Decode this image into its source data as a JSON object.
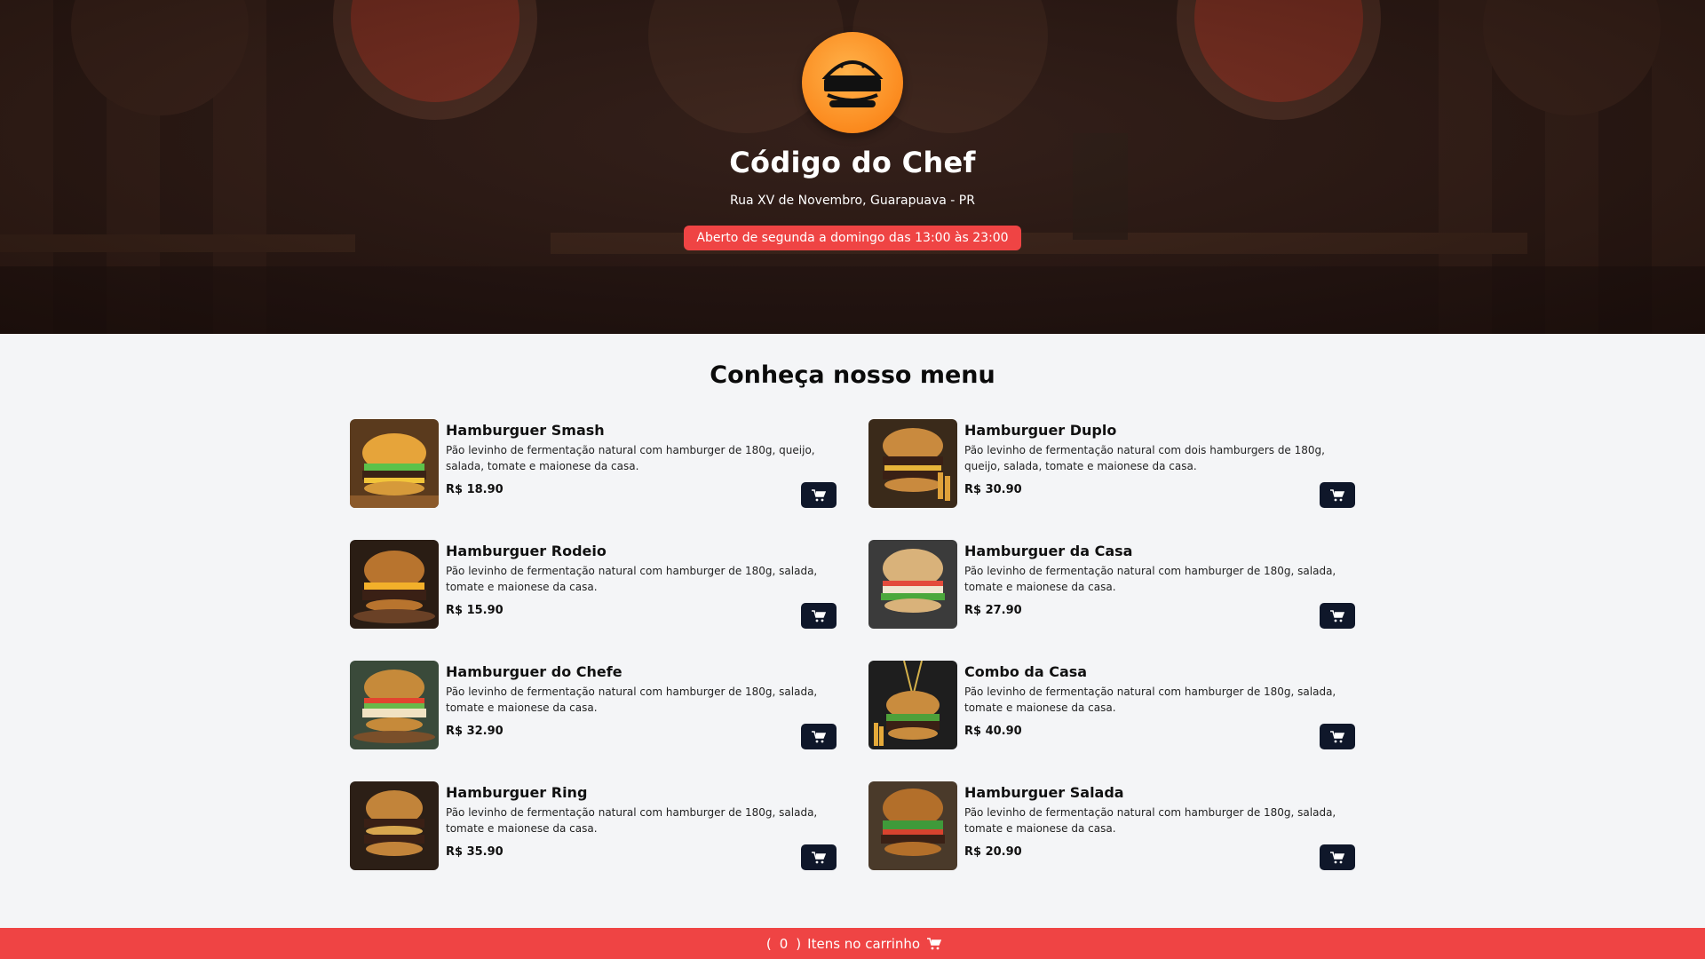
{
  "header": {
    "logo_icon": "burger-logo-icon",
    "title": "Código do Chef",
    "address": "Rua XV de Novembro, Guarapuava - PR",
    "hours": "Aberto de segunda a domingo das 13:00 às 23:00"
  },
  "menu": {
    "title": "Conheça nosso menu",
    "items": [
      {
        "name": "Hamburguer Smash",
        "description": "Pão levinho de fermentação natural com hamburger de 180g, queijo, salada, tomate e maionese da casa.",
        "price": "R$ 18.90"
      },
      {
        "name": "Hamburguer Duplo",
        "description": "Pão levinho de fermentação natural com dois hamburgers de 180g, queijo, salada, tomate e maionese da casa.",
        "price": "R$ 30.90"
      },
      {
        "name": "Hamburguer Rodeio",
        "description": "Pão levinho de fermentação natural com hamburger de 180g, salada, tomate e maionese da casa.",
        "price": "R$ 15.90"
      },
      {
        "name": "Hamburguer da Casa",
        "description": "Pão levinho de fermentação natural com hamburger de 180g, salada, tomate e maionese da casa.",
        "price": "R$ 27.90"
      },
      {
        "name": "Hamburguer do Chefe",
        "description": "Pão levinho de fermentação natural com hamburger de 180g, salada, tomate e maionese da casa.",
        "price": "R$ 32.90"
      },
      {
        "name": "Combo da Casa",
        "description": "Pão levinho de fermentação natural com hamburger de 180g, salada, tomate e maionese da casa.",
        "price": "R$ 40.90"
      },
      {
        "name": "Hamburguer Ring",
        "description": "Pão levinho de fermentação natural com hamburger de 180g, salada, tomate e maionese da casa.",
        "price": "R$ 35.90"
      },
      {
        "name": "Hamburguer Salada",
        "description": "Pão levinho de fermentação natural com hamburger de 180g, salada, tomate e maionese da casa.",
        "price": "R$ 20.90"
      }
    ]
  },
  "cart_bar": {
    "open_paren": "(",
    "count": "0",
    "close_paren": ")",
    "label": "Itens no carrinho",
    "icon": "cart-icon"
  },
  "colors": {
    "accent": "#ef4444",
    "button_dark": "#0f172a",
    "logo_orange": "#fb8a1e"
  }
}
